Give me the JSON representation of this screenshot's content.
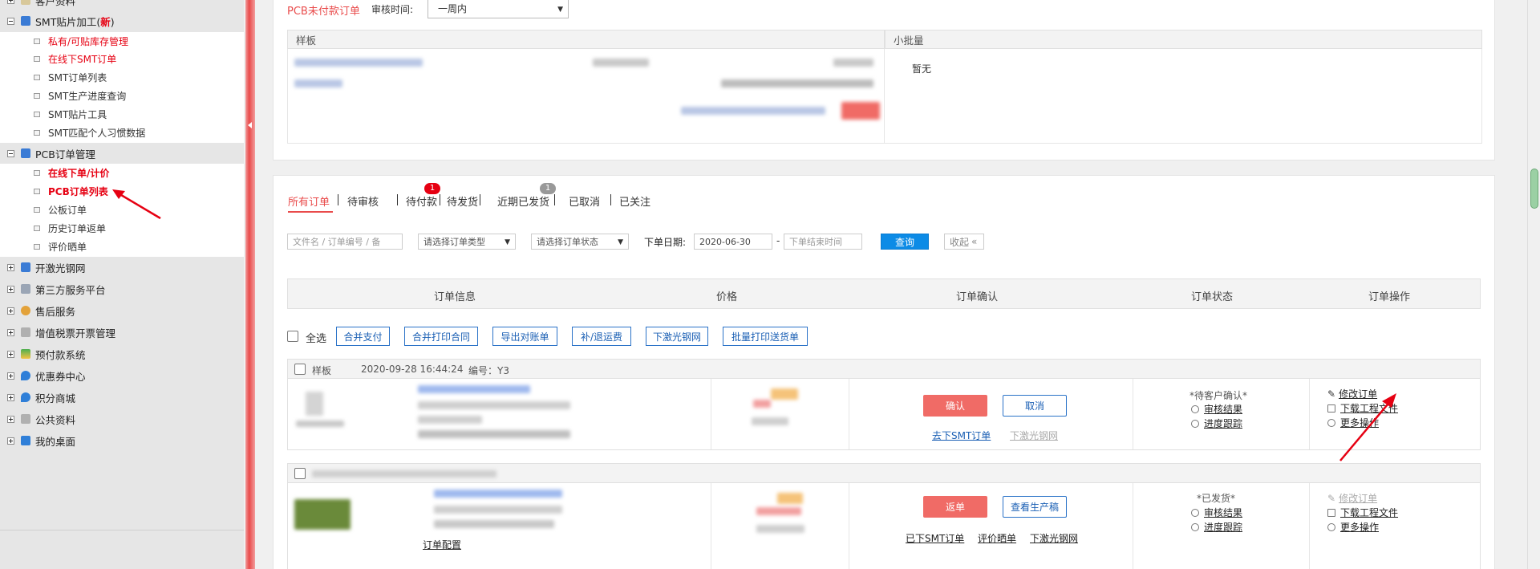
{
  "sidebar": {
    "top_group": "客户资料",
    "groups": [
      {
        "label": "SMT贴片加工(",
        "new": "新",
        "close": ")",
        "expanded": true,
        "items": [
          {
            "label": "私有/可贴库存管理",
            "style": "red"
          },
          {
            "label": "在线下SMT订单",
            "style": "red"
          },
          {
            "label": "SMT订单列表",
            "style": ""
          },
          {
            "label": "SMT生产进度查询",
            "style": ""
          },
          {
            "label": "SMT贴片工具",
            "style": ""
          },
          {
            "label": "SMT匹配个人习惯数据",
            "style": ""
          }
        ]
      },
      {
        "label": "PCB订单管理",
        "expanded": true,
        "items": [
          {
            "label": "在线下单/计价",
            "style": "red bold"
          },
          {
            "label": "PCB订单列表",
            "style": "red bold"
          },
          {
            "label": "公板订单",
            "style": ""
          },
          {
            "label": "历史订单返单",
            "style": ""
          },
          {
            "label": "评价晒单",
            "style": ""
          }
        ]
      },
      {
        "label": "开激光钢网"
      },
      {
        "label": "第三方服务平台"
      },
      {
        "label": "售后服务"
      },
      {
        "label": "增值税票开票管理"
      },
      {
        "label": "预付款系统"
      },
      {
        "label": "优惠券中心"
      },
      {
        "label": "积分商城"
      },
      {
        "label": "公共资料"
      },
      {
        "label": "我的桌面"
      }
    ]
  },
  "unpaid": {
    "title": "PCB未付款订单",
    "audit_label": "审核时间:",
    "audit_value": "一周内",
    "col_sample": "样板",
    "col_batch": "小批量",
    "empty": "暂无"
  },
  "tabs": [
    {
      "label": "所有订单",
      "active": true
    },
    {
      "label": "待审核"
    },
    {
      "label": "待付款",
      "badge": "1"
    },
    {
      "label": "待发货"
    },
    {
      "label": "近期已发货",
      "badge": "1"
    },
    {
      "label": "已取消"
    },
    {
      "label": "已关注"
    }
  ],
  "filters": {
    "search_placeholder": "文件名 / 订单编号 / 备",
    "order_type": "请选择订单类型",
    "order_status": "请选择订单状态",
    "date_label": "下单日期:",
    "date_from": "2020-06-30",
    "date_to_placeholder": "下单结束时间",
    "query": "查询",
    "collapse": "收起"
  },
  "table": {
    "headers": [
      "订单信息",
      "价格",
      "订单确认",
      "订单状态",
      "订单操作"
    ]
  },
  "bulk": {
    "select_all": "全选",
    "actions": [
      "合并支付",
      "合并打印合同",
      "导出对账单",
      "补/退运费",
      "下激光钢网",
      "批量打印送货单"
    ]
  },
  "orders": [
    {
      "type": "样板",
      "date": "2020-09-28 16:44:24",
      "no": "编号：Y3",
      "primary": "确认",
      "secondary": "取消",
      "links": [
        "去下SMT订单",
        "下激光钢网"
      ],
      "status": "*待客户确认*",
      "status_links": [
        "审核结果",
        "进度跟踪"
      ],
      "ops": [
        "修改订单",
        "下载工程文件",
        "更多操作"
      ]
    },
    {
      "primary": "返单",
      "secondary": "查看生产稿",
      "links": [
        "已下SMT订单",
        "评价晒单",
        "下激光钢网"
      ],
      "status": "*已发货*",
      "status_links": [
        "审核结果",
        "进度跟踪"
      ],
      "ops": [
        "修改订单",
        "下载工程文件",
        "更多操作"
      ],
      "extra": "订单配置"
    }
  ],
  "colors": {
    "accent_red": "#e94b4b",
    "link_blue": "#1a5fb4",
    "btn_blue": "#0c8be6"
  }
}
